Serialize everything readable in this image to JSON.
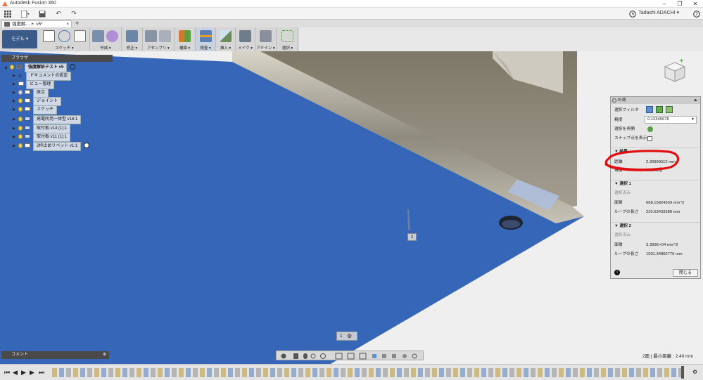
{
  "app": {
    "title": "Autodesk Fusion 360",
    "user": "Tadashi ADACHI ▾"
  },
  "window_controls": [
    "–",
    "❐",
    "✕"
  ],
  "qat": {
    "icons": [
      "grid-icon",
      "file-icon",
      "save-icon",
      "undo-icon",
      "redo-icon"
    ],
    "right_icons": [
      "clock-icon",
      "help-icon"
    ]
  },
  "doc_tab": {
    "label": "強度解…ト v5*",
    "close": "×",
    "add": "+"
  },
  "toolbar": {
    "mode": "モデル ▾",
    "groups": [
      {
        "label": "スケッチ ▾",
        "color": "#4a76b0"
      },
      {
        "label": "作成 ▾",
        "color": "#7a8fb0"
      },
      {
        "label": "修正 ▾",
        "color": "#6c86a8"
      },
      {
        "label": "アセンブリ ▾",
        "color": "#8893a3"
      },
      {
        "label": "構築 ▾",
        "color": "#d07a2e"
      },
      {
        "label": "検査 ▾",
        "color": "#e0a030"
      },
      {
        "label": "挿入 ▾",
        "color": "#6a8b5a"
      },
      {
        "label": "メイク ▾",
        "color": "#6e7c8c"
      },
      {
        "label": "アドイン ▾",
        "color": "#8a8fa0"
      },
      {
        "label": "選択 ▾",
        "color": "#5aa040"
      }
    ]
  },
  "browser": {
    "title": "ブラウザ",
    "items": [
      {
        "label": "強度解析テスト v5",
        "icon": "document"
      },
      {
        "label": "ドキュメントの設定",
        "icon": "gear"
      },
      {
        "label": "ビュー管理",
        "icon": "folder"
      },
      {
        "label": "原点",
        "icon": "folder"
      },
      {
        "label": "ジョイント",
        "icon": "folder"
      },
      {
        "label": "スケッチ",
        "icon": "folder"
      },
      {
        "label": "発電所用一体型 v16:1",
        "icon": "component"
      },
      {
        "label": "取付板 v14 (1):1",
        "icon": "component"
      },
      {
        "label": "取付板 v11 (1):1",
        "icon": "component"
      },
      {
        "label": "2枠止めリベット v1:1",
        "icon": "component"
      }
    ]
  },
  "measure": {
    "title": "計測",
    "rows": [
      {
        "label": "選択フィルタ",
        "value": ""
      },
      {
        "label": "精度",
        "value": "0.12345678"
      },
      {
        "label": "選択を再開",
        "value": ""
      },
      {
        "label": "スナップ点を表示",
        "value": ""
      }
    ],
    "result": {
      "title": "結果",
      "distance_label": "距離",
      "distance": "2.39999512 mm",
      "angle_label": "角度",
      "angle": "0.00 deg"
    },
    "sel1": {
      "title": "選択 1",
      "kind": "選択済み",
      "area_label": "面積",
      "area": "668.15824959 mm^2",
      "loop_label": "ループの長さ",
      "loop": "220.63433388 mm"
    },
    "sel2": {
      "title": "選択 2",
      "kind": "選択済み",
      "area_label": "面積",
      "area": "3.390E+04 mm^2",
      "loop_label": "ループの長さ",
      "loop": "1001.34866776 mm"
    },
    "close": "閉じる"
  },
  "viewport": {
    "badge": "2",
    "page": "1"
  },
  "comment": {
    "label": "コメント"
  },
  "status": {
    "text": "2面 | 最小距離 : 2.40 mm"
  },
  "colors": {
    "face_blue": "#3566b8",
    "plate": "#8a8578",
    "annotation_red": "#e01010"
  }
}
